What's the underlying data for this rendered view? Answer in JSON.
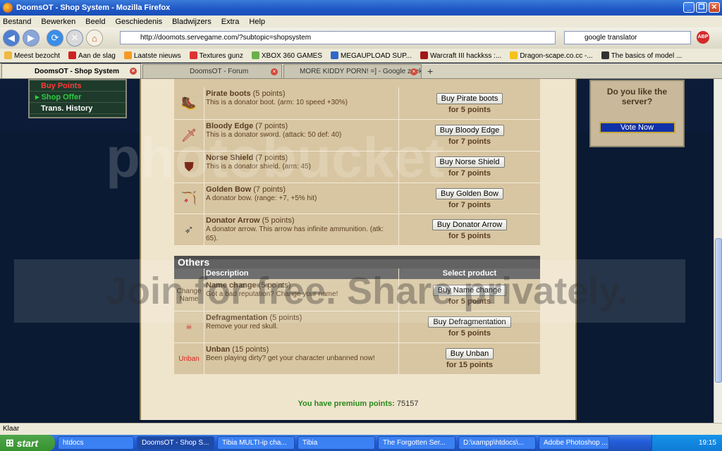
{
  "window": {
    "title": "DoomsOT - Shop System - Mozilla Firefox"
  },
  "menu": [
    "Bestand",
    "Bewerken",
    "Beeld",
    "Geschiedenis",
    "Bladwijzers",
    "Extra",
    "Help"
  ],
  "nav": {
    "url": "http://doomots.servegame.com/?subtopic=shopsystem",
    "search": "google translator"
  },
  "bookmarks": [
    "Meest bezocht",
    "Aan de slag",
    "Laatste nieuws",
    "Textures gunz",
    "XBOX 360 GAMES",
    "MEGAUPLOAD SUP...",
    "Warcraft III hackkss :...",
    "Dragon-scape.co.cc -...",
    "The basics of model ..."
  ],
  "tabs": [
    "DoomsOT - Shop System",
    "DoomsOT - Forum",
    "MORE KIDDY PORN! =] - Google zoeken"
  ],
  "sidebar": {
    "items": [
      "Buy Points",
      "Shop Offer",
      "Trans. History"
    ]
  },
  "items": [
    {
      "name": "Pirate boots",
      "points": "(5 points)",
      "desc": "This is a donator boot. (arm: 10 speed +30%)",
      "button": "Buy Pirate boots",
      "for": "for 5 points"
    },
    {
      "name": "Bloody Edge",
      "points": "(7 points)",
      "desc": "This is a donator sword. (attack: 50 def: 40)",
      "button": "Buy Bloody Edge",
      "for": "for 7 points"
    },
    {
      "name": "Norse Shield",
      "points": "(7 points)",
      "desc": "This is a donator shield. (arm: 45)",
      "button": "Buy Norse Shield",
      "for": "for 7 points"
    },
    {
      "name": "Golden Bow",
      "points": "(7 points)",
      "desc": "A donator bow. (range: +7, +5% hit)",
      "button": "Buy Golden Bow",
      "for": "for 7 points"
    },
    {
      "name": "Donator Arrow",
      "points": "(5 points)",
      "desc": "A donator arrow. This arrow has infinite ammunition. (atk: 65).",
      "button": "Buy Donator Arrow",
      "for": "for 5 points"
    }
  ],
  "others": {
    "header": "Others",
    "col_desc": "Description",
    "col_select": "Select product",
    "rows": [
      {
        "label": "Change Name",
        "name": "Name change",
        "points": "(5 points)",
        "desc": "Got a bad reputation? Change your name!",
        "button": "Buy Name change",
        "for": "for 5 points"
      },
      {
        "label": "",
        "name": "Defragmentation",
        "points": "(5 points)",
        "desc": "Remove your red skull.",
        "button": "Buy Defragmentation",
        "for": "for 5 points"
      },
      {
        "label": "Unban",
        "name": "Unban",
        "points": "(15 points)",
        "desc": "Been playing dirty? get your character unbanned now!",
        "button": "Buy Unban",
        "for": "for 15 points"
      }
    ]
  },
  "premium": {
    "label": "You have premium points:",
    "value": "75157"
  },
  "poll": {
    "question": "Do you like the server?",
    "button": "Vote Now"
  },
  "status": "Klaar",
  "taskbar": {
    "start": "start",
    "items": [
      "htdocs",
      "DoomsOT - Shop S...",
      "Tibia MULTI-ip cha...",
      "Tibia",
      "The Forgotten Ser...",
      "D:\\xampp\\htdocs\\...",
      "Adobe Photoshop ..."
    ],
    "clock": "19:15"
  },
  "watermark": {
    "logo": "photobucket",
    "banner": "Join for free. Share privately."
  }
}
